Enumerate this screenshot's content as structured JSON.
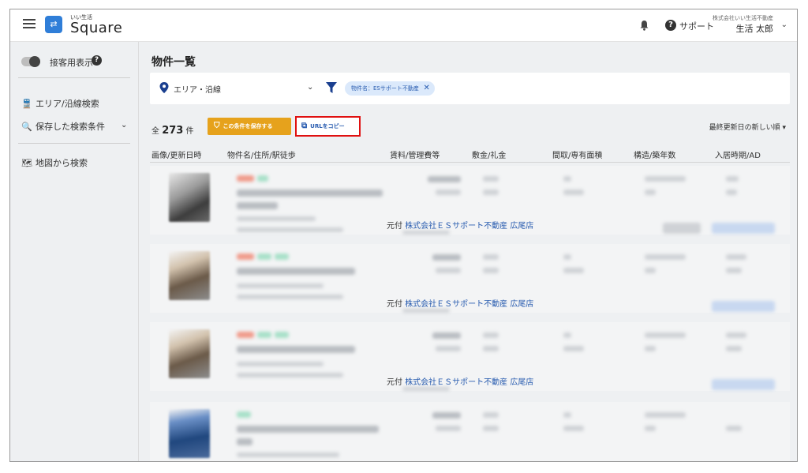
{
  "header": {
    "menu_icon": "hamburger-icon",
    "logo_sub": "いい生活",
    "logo_text": "Square",
    "logo_icon": "square-logo-icon",
    "support_label": "サポート",
    "company_name": "株式会社いい生活不動産",
    "user_name": "生活 太郎"
  },
  "sidebar": {
    "toggle_label": "接客用表示",
    "items": [
      {
        "label": "エリア/沿線検索",
        "icon": "train-icon"
      },
      {
        "label": "保存した検索条件",
        "icon": "saved-search-icon"
      },
      {
        "label": "地図から検索",
        "icon": "map-search-icon"
      }
    ]
  },
  "main": {
    "page_title": "物件一覧",
    "area_select": "エリア・沿線",
    "filter_chip": "物件名：ESサポート不動産",
    "count_prefix": "全",
    "count": "273",
    "count_suffix": "件",
    "save_button": "この条件を保存する",
    "copy_url_button": "URLをコピー",
    "sort_label": "最終更新日の新しい順",
    "columns": [
      "画像/更新日時",
      "物件名/住所/駅徒歩",
      "賃料/管理費等",
      "敷金/礼金",
      "間取/専有面積",
      "構造/築年数",
      "入居時期/AD"
    ],
    "agency_prefix": "元付",
    "agency_name": "株式会社ＥＳサポート不動産 広尾店"
  },
  "colors": {
    "accent_blue": "#2f7ed8",
    "save_orange": "#e6a21c",
    "highlight_red": "#e01010"
  }
}
